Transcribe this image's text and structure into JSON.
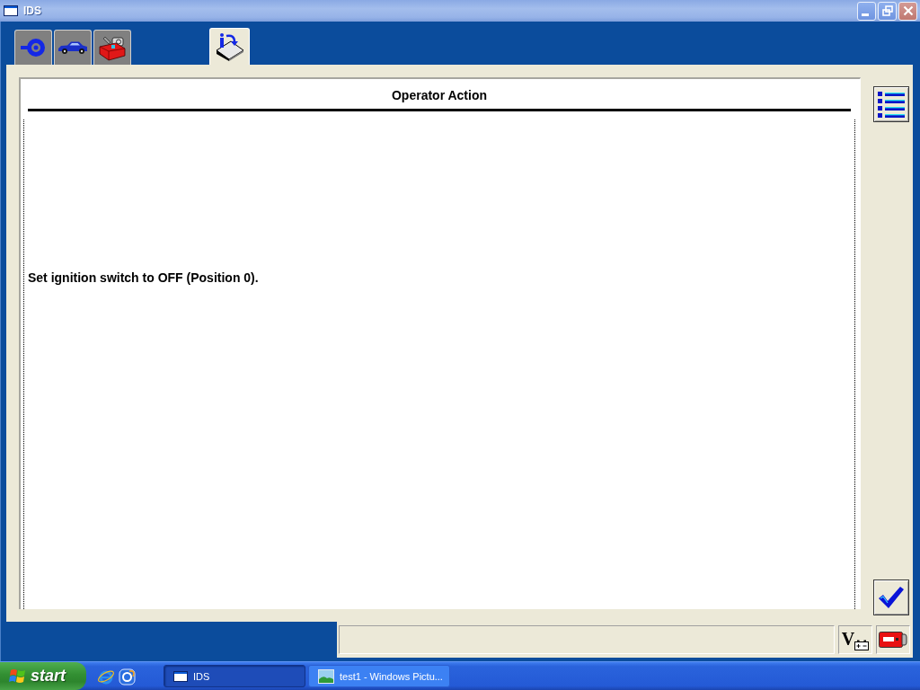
{
  "window": {
    "title": "IDS"
  },
  "tabs": [
    {
      "kind": "connector",
      "selected": false
    },
    {
      "kind": "vehicle",
      "selected": false
    },
    {
      "kind": "toolbox",
      "selected": false
    },
    {
      "kind": "info",
      "selected": true
    }
  ],
  "panel": {
    "title": "Operator Action",
    "message": "Set ignition switch to OFF (Position 0)."
  },
  "status_bar": {
    "voltage_symbol": "V"
  },
  "taskbar": {
    "start": "start",
    "tasks": [
      {
        "kind": "window",
        "label": "IDS",
        "selected": true
      },
      {
        "kind": "picture",
        "label": "test1 - Windows Pictu...",
        "selected": false
      }
    ]
  }
}
